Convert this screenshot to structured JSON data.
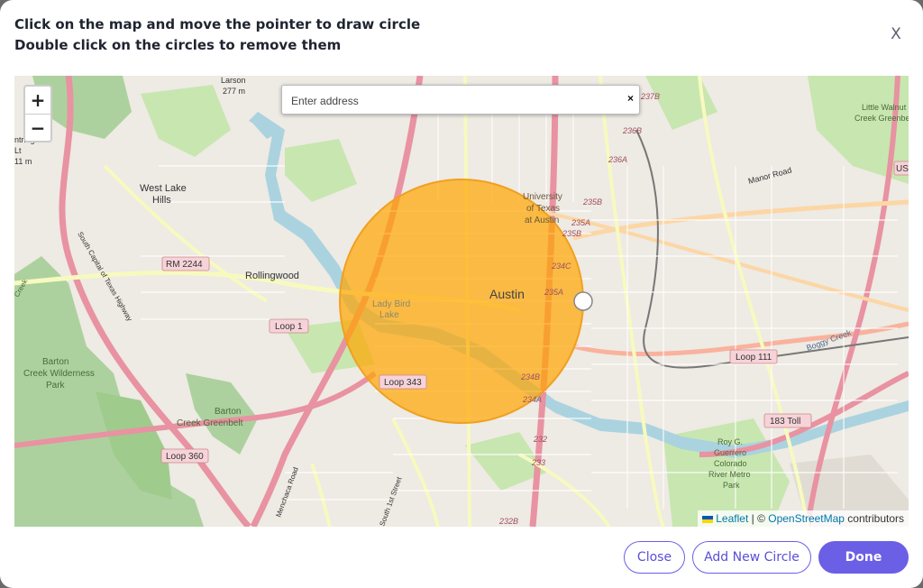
{
  "instructions": {
    "line1": "Click on the map and move the pointer to draw circle",
    "line2": "Double click on the circles to remove them"
  },
  "close_icon_glyph": "X",
  "map": {
    "zoom_in": "+",
    "zoom_out": "−",
    "search": {
      "placeholder": "Enter address",
      "clear": "×"
    },
    "labels": {
      "austin": "Austin",
      "west_lake_hills": "West Lake",
      "west_lake_hills2": "Hills",
      "rollingwood": "Rollingwood",
      "barton_creek_wilderness": "Barton",
      "barton_creek_wilderness2": "Creek Wilderness",
      "barton_creek_wilderness3": "Park",
      "barton_creek_greenbelt": "Barton",
      "barton_creek_greenbelt2": "Creek Greenbelt",
      "university": "University",
      "university2": "of Texas",
      "university3": "at Austin",
      "larson": "Larson",
      "larson_elev": "277 m",
      "little_walnut": "Little Walnut",
      "little_walnut2": "Creek Greenbelt",
      "manor_road": "Manor Road",
      "roy_g": "Roy G.",
      "roy_g2": "Guerrero",
      "roy_g3": "Colorado",
      "roy_g4": "River Metro",
      "roy_g5": "Park",
      "lady_bird": "Lady Bird",
      "lady_bird2": "Lake",
      "south_capital": "South Capital of Texas Highway",
      "menchaca": "Menchaca Road",
      "south_first": "South 1st Street",
      "boggy_creek": "Boggy Creek",
      "trinkage": "ntridge",
      "elev_left": "11 m",
      "lt": "Lt",
      "creek_left": "Creek"
    },
    "shields": {
      "rm2244": "RM 2244",
      "loop1": "Loop 1",
      "loop343": "Loop 343",
      "loop360": "Loop 360",
      "loop111": "Loop 111",
      "toll183": "183 Toll",
      "us": "US"
    },
    "exits": [
      "237B",
      "236B",
      "236A",
      "235B",
      "235A",
      "235B",
      "234C",
      "235A",
      "234B",
      "234A",
      "232",
      "233",
      "232B"
    ],
    "attribution": {
      "leaflet": "Leaflet",
      "sep": " | © ",
      "osm": "OpenStreetMap",
      "tail": " contributors"
    },
    "circle": {
      "fill": "#ffa500",
      "stroke": "#f0a020",
      "opacity": 0.7
    }
  },
  "buttons": {
    "close": "Close",
    "add_new_circle": "Add New Circle",
    "done": "Done"
  },
  "colors": {
    "accent": "#6b5fe6",
    "water": "#aad3df",
    "park": "#c8e6b0",
    "forest": "#add19e",
    "highway": "#e892a2"
  }
}
